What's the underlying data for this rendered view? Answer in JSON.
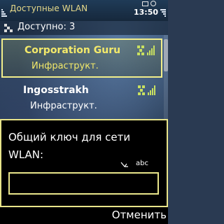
{
  "status_bar": {
    "title": "Доступные WLAN",
    "time": "13:50"
  },
  "available": {
    "label": "Доступно: 3"
  },
  "networks": [
    {
      "name": "Corporation Guru",
      "type": "Инфраструкт.",
      "selected": true
    },
    {
      "name": "Ingosstrakh",
      "type": "Инфраструкт.",
      "selected": false
    }
  ],
  "dialog": {
    "prompt": "Общий ключ для сети WLAN:",
    "input_mode": "abc",
    "input_value": ""
  },
  "softkeys": {
    "right": "Отменить"
  },
  "colors": {
    "highlight": "#f3e96a",
    "border": "#e8e48a",
    "signal_icon": "#c8e060"
  }
}
